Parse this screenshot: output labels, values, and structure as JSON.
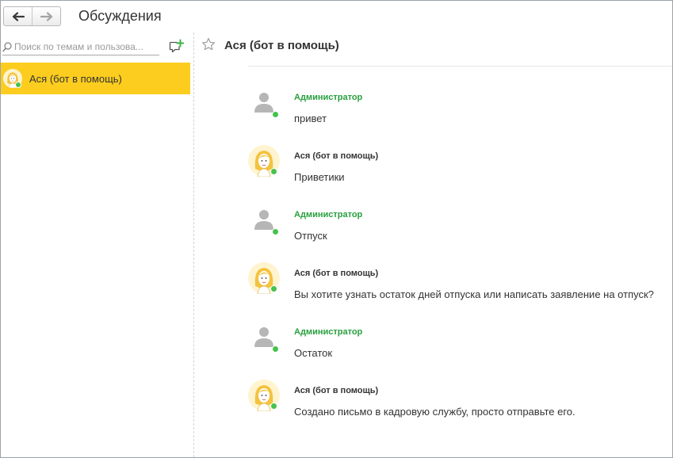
{
  "window": {
    "title": "Обсуждения"
  },
  "nav": {
    "back_icon": "arrow-left-icon",
    "forward_icon": "arrow-right-icon"
  },
  "sidebar": {
    "search_placeholder": "Поиск по темам и пользова...",
    "new_discussion_icon": "add-chat-icon",
    "items": [
      {
        "label": "Ася (бот в помощь)",
        "selected": true,
        "online": true
      }
    ]
  },
  "chat": {
    "title": "Ася (бот в помощь)",
    "favorite_icon": "star-icon",
    "messages": [
      {
        "author": "Администратор",
        "role": "admin",
        "text": "привет"
      },
      {
        "author": "Ася (бот в помощь)",
        "role": "bot",
        "text": "Приветики"
      },
      {
        "author": "Администратор",
        "role": "admin",
        "text": "Отпуск"
      },
      {
        "author": "Ася (бот в помощь)",
        "role": "bot",
        "text": "Вы хотите узнать остаток дней отпуска или написать заявление на отпуск?"
      },
      {
        "author": "Администратор",
        "role": "admin",
        "text": "Остаток"
      },
      {
        "author": "Ася (бот в помощь)",
        "role": "bot",
        "text": "Создано письмо в кадровую службу, просто отправьте его."
      }
    ]
  },
  "colors": {
    "selection": "#fccd1f",
    "admin_name": "#289f3d",
    "online": "#47c24d"
  }
}
